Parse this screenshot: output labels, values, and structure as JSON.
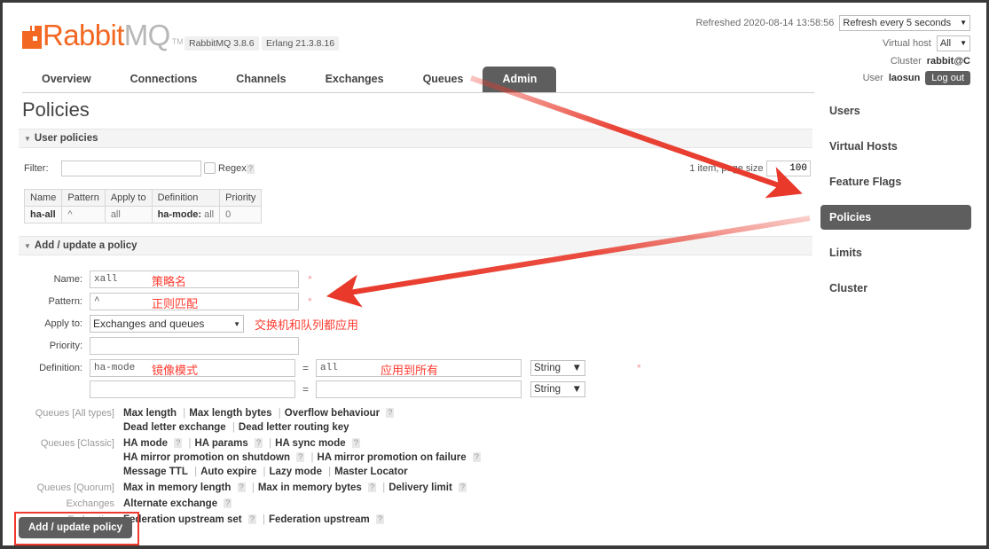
{
  "header": {
    "brand_rabbit": "Rabbit",
    "brand_mq": "MQ",
    "brand_tm": "TM",
    "pill_rabbitmq": "RabbitMQ 3.8.6",
    "pill_erlang": "Erlang 21.3.8.16",
    "refreshed_text": "Refreshed 2020-08-14 13:58:56",
    "refresh_select": "Refresh every 5 seconds",
    "vhost_label": "Virtual host",
    "vhost_select": "All",
    "cluster_label": "Cluster",
    "cluster_value": "rabbit@C",
    "user_label": "User",
    "user_value": "laosun",
    "logout_label": "Log out",
    "caret": "▼"
  },
  "tabs": [
    {
      "label": "Overview",
      "active": false
    },
    {
      "label": "Connections",
      "active": false
    },
    {
      "label": "Channels",
      "active": false
    },
    {
      "label": "Exchanges",
      "active": false
    },
    {
      "label": "Queues",
      "active": false
    },
    {
      "label": "Admin",
      "active": true
    }
  ],
  "rightnav": [
    {
      "label": "Users",
      "active": false
    },
    {
      "label": "Virtual Hosts",
      "active": false
    },
    {
      "label": "Feature Flags",
      "active": false
    },
    {
      "label": "Policies",
      "active": true
    },
    {
      "label": "Limits",
      "active": false
    },
    {
      "label": "Cluster",
      "active": false
    }
  ],
  "main": {
    "page_title": "Policies",
    "section_user_policies": "User policies",
    "section_add_update": "Add / update a policy",
    "tri": "▼"
  },
  "filter": {
    "label": "Filter:",
    "value": "",
    "placeholder": "",
    "regex_label": "Regex",
    "regex_checked": false,
    "help": "?",
    "paging_text": "1 item, page size up to",
    "page_size": "100"
  },
  "policies_table": {
    "columns": [
      "Name",
      "Pattern",
      "Apply to",
      "Definition",
      "Priority"
    ],
    "rows": [
      {
        "name": "ha-all",
        "pattern": "^",
        "apply_to": "all",
        "definition_key": "ha-mode:",
        "definition_value": "all",
        "priority": "0"
      }
    ]
  },
  "form": {
    "name_label": "Name:",
    "name_value": "xall",
    "name_note": "策略名",
    "name_required": "*",
    "pattern_label": "Pattern:",
    "pattern_value": "^",
    "pattern_note": "正则匹配",
    "pattern_required": "*",
    "applyto_label": "Apply to:",
    "applyto_value": "Exchanges and queues",
    "applyto_note": "交换机和队列都应用",
    "priority_label": "Priority:",
    "priority_value": "",
    "definition_label": "Definition:",
    "definition_required": "*",
    "def_rows": [
      {
        "key": "ha-mode",
        "key_note": "镜像模式",
        "value": "all",
        "value_note": "应用到所有",
        "type": "String"
      },
      {
        "key": "",
        "key_note": "",
        "value": "",
        "value_note": "",
        "type": "String"
      }
    ],
    "eq": "=",
    "caret": "▼",
    "submit_label": "Add / update policy"
  },
  "hints": [
    {
      "category": "Queues [All types]",
      "lines": [
        [
          {
            "t": "link",
            "v": "Max length"
          },
          {
            "t": "sep",
            "v": "|"
          },
          {
            "t": "link",
            "v": "Max length bytes"
          },
          {
            "t": "sep",
            "v": "|"
          },
          {
            "t": "link",
            "v": "Overflow behaviour"
          },
          {
            "t": "help",
            "v": "?"
          }
        ],
        [
          {
            "t": "link",
            "v": "Dead letter exchange"
          },
          {
            "t": "sep",
            "v": "|"
          },
          {
            "t": "link",
            "v": "Dead letter routing key"
          }
        ]
      ]
    },
    {
      "category": "Queues [Classic]",
      "lines": [
        [
          {
            "t": "link",
            "v": "HA mode"
          },
          {
            "t": "help",
            "v": "?"
          },
          {
            "t": "sep",
            "v": "|"
          },
          {
            "t": "link",
            "v": "HA params"
          },
          {
            "t": "help",
            "v": "?"
          },
          {
            "t": "sep",
            "v": "|"
          },
          {
            "t": "link",
            "v": "HA sync mode"
          },
          {
            "t": "help",
            "v": "?"
          }
        ],
        [
          {
            "t": "link",
            "v": "HA mirror promotion on shutdown"
          },
          {
            "t": "help",
            "v": "?"
          },
          {
            "t": "sep",
            "v": "|"
          },
          {
            "t": "link",
            "v": "HA mirror promotion on failure"
          },
          {
            "t": "help",
            "v": "?"
          }
        ],
        [
          {
            "t": "link",
            "v": "Message TTL"
          },
          {
            "t": "sep",
            "v": "|"
          },
          {
            "t": "link",
            "v": "Auto expire"
          },
          {
            "t": "sep",
            "v": "|"
          },
          {
            "t": "link",
            "v": "Lazy mode"
          },
          {
            "t": "sep",
            "v": "|"
          },
          {
            "t": "link",
            "v": "Master Locator"
          }
        ]
      ]
    },
    {
      "category": "Queues [Quorum]",
      "lines": [
        [
          {
            "t": "link",
            "v": "Max in memory length"
          },
          {
            "t": "help",
            "v": "?"
          },
          {
            "t": "sep",
            "v": "|"
          },
          {
            "t": "link",
            "v": "Max in memory bytes"
          },
          {
            "t": "help",
            "v": "?"
          },
          {
            "t": "sep",
            "v": "|"
          },
          {
            "t": "link",
            "v": "Delivery limit"
          },
          {
            "t": "help",
            "v": "?"
          }
        ]
      ]
    },
    {
      "category": "Exchanges",
      "lines": [
        [
          {
            "t": "link",
            "v": "Alternate exchange"
          },
          {
            "t": "help",
            "v": "?"
          }
        ]
      ]
    },
    {
      "category": "Federation",
      "lines": [
        [
          {
            "t": "link",
            "v": "Federation upstream set"
          },
          {
            "t": "help",
            "v": "?"
          },
          {
            "t": "sep",
            "v": "|"
          },
          {
            "t": "link",
            "v": "Federation upstream"
          },
          {
            "t": "help",
            "v": "?"
          }
        ]
      ]
    }
  ],
  "annotations": {
    "arrow_color": "#e8392b",
    "highlight_box_color": "#f0382c"
  }
}
